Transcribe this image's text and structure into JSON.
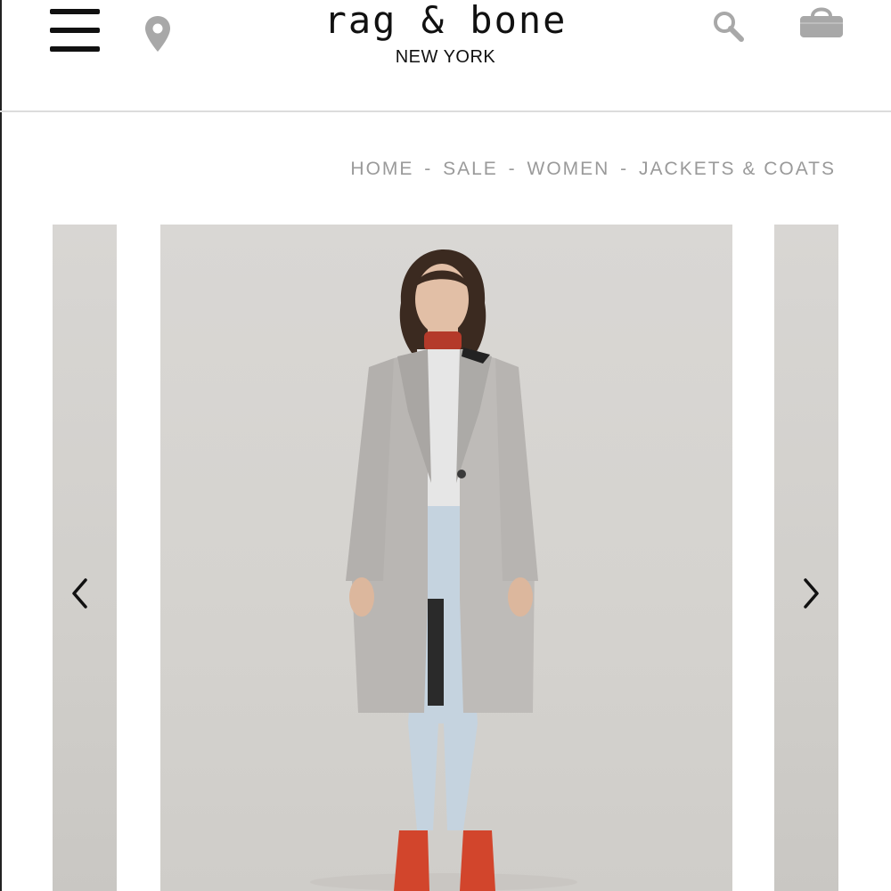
{
  "header": {
    "menu_icon": "hamburger-menu-icon",
    "location_icon": "map-pin-icon",
    "search_icon": "search-icon",
    "bag_icon": "shopping-bag-icon",
    "logo": {
      "brand": "rag & bone",
      "city": "NEW YORK"
    }
  },
  "breadcrumb": {
    "items": [
      "HOME",
      "SALE",
      "WOMEN",
      "JACKETS & COATS"
    ],
    "separator": "-"
  },
  "carousel": {
    "prev_icon": "chevron-left-icon",
    "next_icon": "chevron-right-icon"
  },
  "colors": {
    "text": "#111111",
    "breadcrumb": "#9a9a9a",
    "icon_grey": "#a8a8a8",
    "photo_bg": "#d6d4d0"
  }
}
